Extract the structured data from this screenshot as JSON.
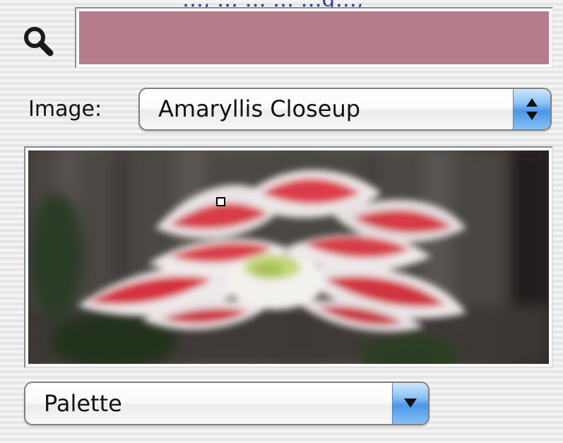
{
  "top_caption": "…, … … … …g…,",
  "search": {
    "icon": "magnifier-icon"
  },
  "selected_color": {
    "hex": "#b57d8a"
  },
  "image_selector": {
    "label": "Image:",
    "selected": "Amaryllis Closeup",
    "arrow_icon": "up-down-chevrons-icon"
  },
  "image_well": {
    "image": "blurred-red-white-amaryllis-flower-photo",
    "cursor_icon": "sample-point-cursor-icon"
  },
  "palette_selector": {
    "selected": "Palette",
    "arrow_icon": "down-triangle-icon"
  },
  "colors": {
    "accent_blue": "#4a97e8",
    "swatch": "#b57d8a"
  }
}
